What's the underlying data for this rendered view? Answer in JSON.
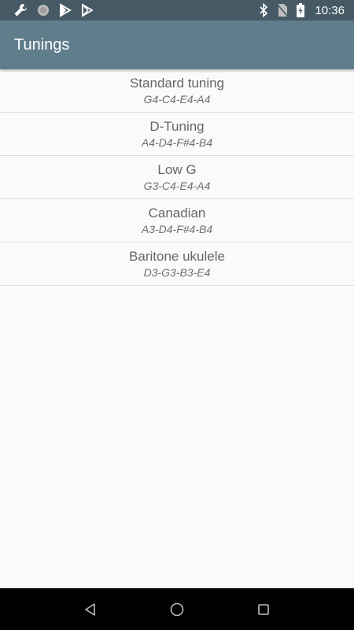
{
  "status_bar": {
    "time": "10:36",
    "left_icons": [
      "wrench-icon",
      "circle-dot-icon",
      "play-store-icon",
      "play-store-outline-icon"
    ],
    "right_icons": [
      "bluetooth-icon",
      "no-sim-icon",
      "battery-charging-icon"
    ]
  },
  "app_bar": {
    "title": "Tunings"
  },
  "tunings": [
    {
      "name": "Standard tuning",
      "notes": "G4-C4-E4-A4"
    },
    {
      "name": "D-Tuning",
      "notes": "A4-D4-F#4-B4"
    },
    {
      "name": "Low G",
      "notes": "G3-C4-E4-A4"
    },
    {
      "name": "Canadian",
      "notes": "A3-D4-F#4-B4"
    },
    {
      "name": "Baritone ukulele",
      "notes": "D3-G3-B3-E4"
    }
  ],
  "nav_bar": {
    "buttons": [
      "back-icon",
      "home-icon",
      "recents-icon"
    ]
  },
  "colors": {
    "status_bar": "#455a64",
    "app_bar": "#607d8b",
    "background": "#fafafa"
  }
}
